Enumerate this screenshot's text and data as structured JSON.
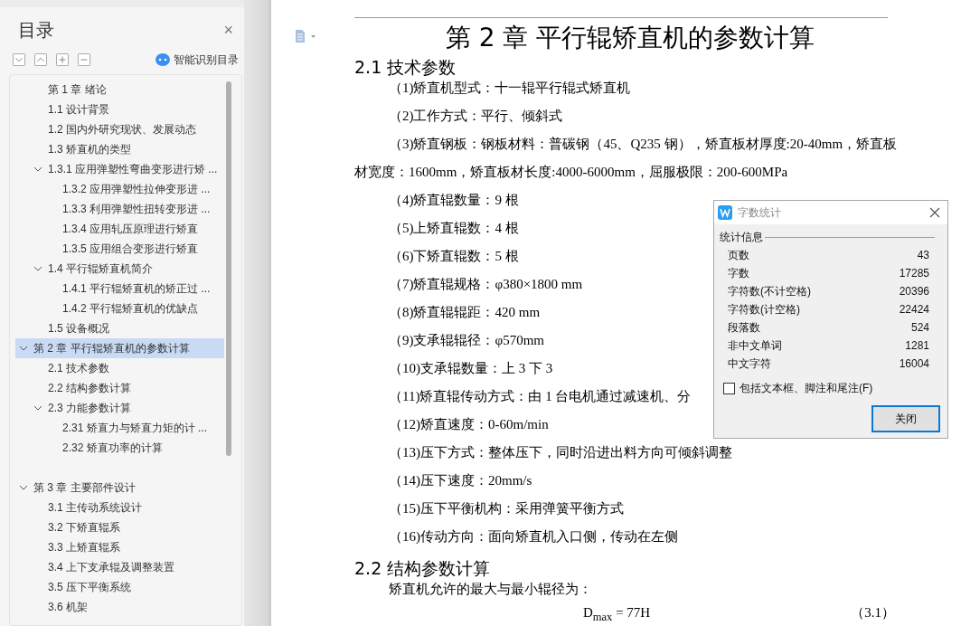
{
  "sidebar": {
    "title": "目录",
    "close": "×",
    "smart_button": "智能识别目录",
    "toc": [
      {
        "children": [
          {
            "label": "第 1 章  绪论",
            "selected": false
          },
          {
            "label": "1.1  设计背景",
            "selected": false
          },
          {
            "label": "1.2  国内外研究现状、发展动态",
            "selected": false
          },
          {
            "label": "1.3 矫直机的类型",
            "selected": false
          },
          {
            "label": "1.3.1 应用弹塑性弯曲变形进行矫 ...",
            "selected": false,
            "expanded": true,
            "children": [
              {
                "label": "1.3.2 应用弹塑性拉伸变形进 ...",
                "selected": false
              },
              {
                "label": "1.3.3 利用弹塑性扭转变形进 ...",
                "selected": false
              },
              {
                "label": "1.3.4 应用轧压原理进行矫直",
                "selected": false
              },
              {
                "label": "1.3.5 应用组合变形进行矫直",
                "selected": false
              }
            ]
          },
          {
            "label": "1.4  平行辊矫直机简介",
            "selected": false,
            "expanded": true,
            "children": [
              {
                "label": "1.4.1 平行辊矫直机的矫正过 ...",
                "selected": false
              },
              {
                "label": "1.4.2 平行辊矫直机的优缺点",
                "selected": false
              }
            ]
          },
          {
            "label": "1.5  设备概况",
            "selected": false
          }
        ]
      },
      {
        "label": "第 2 章  平行辊矫直机的参数计算",
        "selected": true,
        "expanded": true,
        "children": [
          {
            "label": "2.1  技术参数",
            "selected": false
          },
          {
            "label": "2.2  结构参数计算",
            "selected": false
          },
          {
            "label": "2.3  力能参数计算",
            "selected": false,
            "expanded": true,
            "children": [
              {
                "label": "2.31  矫直力与矫直力矩的计 ...",
                "selected": false
              },
              {
                "label": "2.32  矫直功率的计算",
                "selected": false
              }
            ]
          }
        ]
      },
      {
        "label": "第 3 章  主要部件设计",
        "selected": false,
        "expanded": true,
        "children": [
          {
            "label": "3.1 主传动系统设计",
            "selected": false
          },
          {
            "label": "3.2 下矫直辊系",
            "selected": false
          },
          {
            "label": "3.3 上矫直辊系",
            "selected": false
          },
          {
            "label": "3.4 上下支承辊及调整装置",
            "selected": false
          },
          {
            "label": "3.5 压下平衡系统",
            "selected": false
          },
          {
            "label": "3.6 机架",
            "selected": false
          }
        ]
      }
    ]
  },
  "document": {
    "blocks": [
      {
        "kind": "title",
        "text": "第 2 章  平行辊矫直机的参数计算"
      },
      {
        "kind": "heading",
        "text": "2.1  技术参数"
      },
      {
        "kind": "para",
        "text": "（1)矫直机型式：十一辊平行辊式矫直机"
      },
      {
        "kind": "para",
        "text": "（2)工作方式：平行、倾斜式"
      },
      {
        "kind": "para",
        "text": "（3)矫直钢板：钢板材料：普碳钢（45、Q235 钢），矫直板材厚度:20-40mm，矫直板材宽度：1600mm，矫直板材长度:4000-6000mm，屈服极限：200-600MPa"
      },
      {
        "kind": "para",
        "text": "（4)矫直辊数量：9 根"
      },
      {
        "kind": "para",
        "text": "（5)上矫直辊数：4 根"
      },
      {
        "kind": "para",
        "text": "（6)下矫直辊数：5 根"
      },
      {
        "kind": "para",
        "text": "（7)矫直辊规格：φ380×1800 mm"
      },
      {
        "kind": "para",
        "text": "（8)矫直辊辊距：420 mm"
      },
      {
        "kind": "para",
        "text": "（9)支承辊辊径：φ570mm"
      },
      {
        "kind": "para",
        "text": "（10)支承辊数量：上 3 下 3"
      },
      {
        "kind": "para",
        "text": "（11)矫直辊传动方式：由 1 台电机通过减速机、分"
      },
      {
        "kind": "para",
        "text": "（12)矫直速度：0-60m/min"
      },
      {
        "kind": "para",
        "text": "（13)压下方式：整体压下，同时沿进出料方向可倾斜调整"
      },
      {
        "kind": "para",
        "text": "（14)压下速度：20mm/s"
      },
      {
        "kind": "para",
        "text": "（15)压下平衡机构：采用弹簧平衡方式"
      },
      {
        "kind": "para",
        "text": "（16)传动方向：面向矫直机入口侧，传动在左侧"
      },
      {
        "kind": "heading",
        "text": "2.2  结构参数计算"
      },
      {
        "kind": "para",
        "text": "矫直机允许的最大与最小辊径为："
      },
      {
        "kind": "formula",
        "text": "D$_{max}$ = 77H",
        "number": "（3.1）"
      }
    ]
  },
  "dialog": {
    "title": "字数统计",
    "group": "统计信息",
    "stats": [
      {
        "label": "页数",
        "value": "43"
      },
      {
        "label": "字数",
        "value": "17285"
      },
      {
        "label": "字符数(不计空格)",
        "value": "20396"
      },
      {
        "label": "字符数(计空格)",
        "value": "22424"
      },
      {
        "label": "段落数",
        "value": "524"
      },
      {
        "label": "非中文单词",
        "value": "1281"
      },
      {
        "label": "中文字符",
        "value": "16004"
      }
    ],
    "checkbox": {
      "label": "包括文本框、脚注和尾注(F)",
      "checked": false
    },
    "button": "关闭"
  }
}
